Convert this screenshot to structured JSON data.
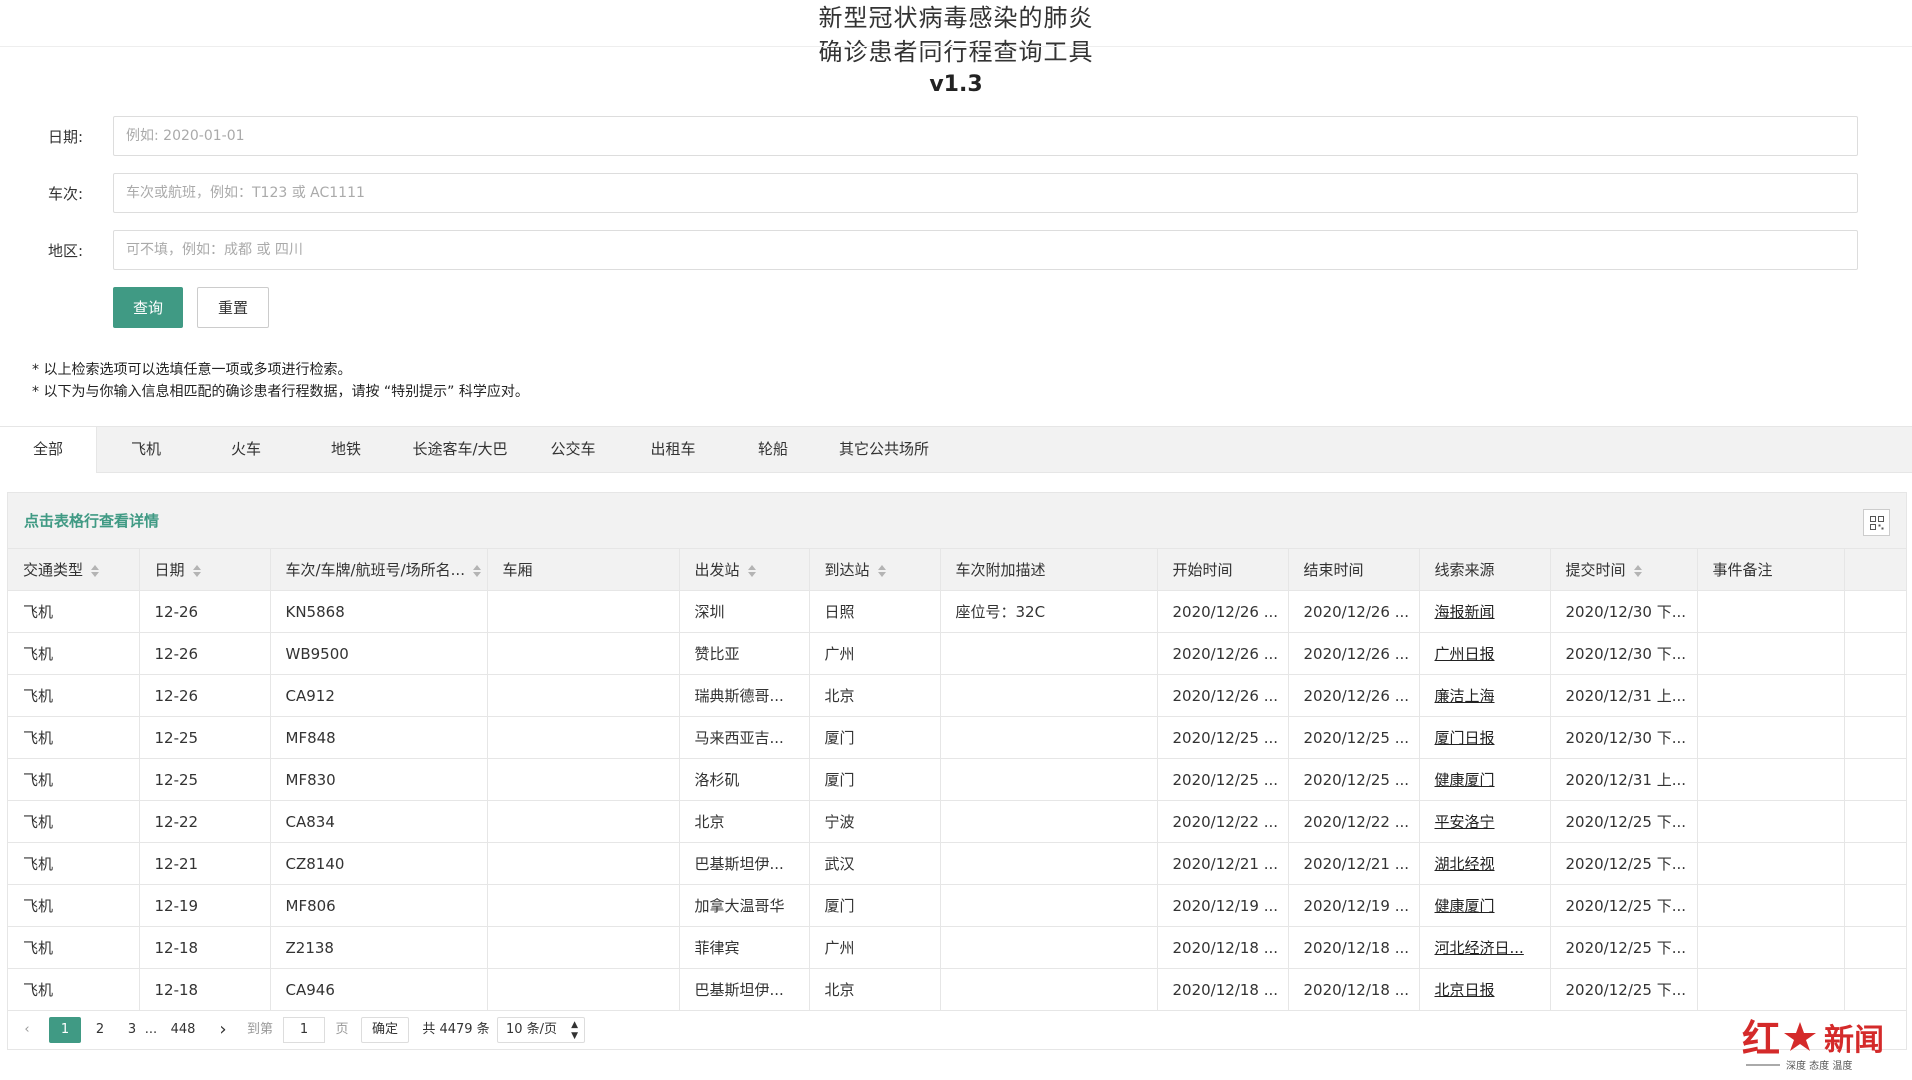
{
  "header": {
    "title_line1": "新型冠状病毒感染的肺炎",
    "title_line2": "确诊患者同行程查询工具",
    "version": "v1.3"
  },
  "form": {
    "date_label": "日期:",
    "date_placeholder": "例如: 2020-01-01",
    "train_label": "车次:",
    "train_placeholder": "车次或航班，例如：T123 或 AC1111",
    "region_label": "地区:",
    "region_placeholder": "可不填，例如：成都 或 四川",
    "query_button": "查询",
    "reset_button": "重置"
  },
  "notes": [
    "* 以上检索选项可以选填任意一项或多项进行检索。",
    "* 以下为与你输入信息相匹配的确诊患者行程数据，请按 “特别提示” 科学应对。"
  ],
  "tabs": [
    "全部",
    "飞机",
    "火车",
    "地铁",
    "长途客车/大巴",
    "公交车",
    "出租车",
    "轮船",
    "其它公共场所"
  ],
  "table": {
    "hint": "点击表格行查看详情",
    "columns": [
      "交通类型",
      "日期",
      "车次/车牌/航班号/场所名...",
      "车厢",
      "出发站",
      "到达站",
      "车次附加描述",
      "开始时间",
      "结束时间",
      "线索来源",
      "提交时间",
      "事件备注"
    ],
    "rows": [
      [
        "飞机",
        "12-26",
        "KN5868",
        "",
        "深圳",
        "日照",
        "座位号：32C",
        "2020/12/26 ...",
        "2020/12/26 ...",
        "海报新闻",
        "2020/12/30 下...",
        ""
      ],
      [
        "飞机",
        "12-26",
        "WB9500",
        "",
        "赞比亚",
        "广州",
        "",
        "2020/12/26 ...",
        "2020/12/26 ...",
        "广州日报",
        "2020/12/30 下...",
        ""
      ],
      [
        "飞机",
        "12-26",
        "CA912",
        "",
        "瑞典斯德哥...",
        "北京",
        "",
        "2020/12/26 ...",
        "2020/12/26 ...",
        "廉洁上海",
        "2020/12/31 上...",
        ""
      ],
      [
        "飞机",
        "12-25",
        "MF848",
        "",
        "马来西亚吉...",
        "厦门",
        "",
        "2020/12/25 ...",
        "2020/12/25 ...",
        "厦门日报",
        "2020/12/30 下...",
        ""
      ],
      [
        "飞机",
        "12-25",
        "MF830",
        "",
        "洛杉矶",
        "厦门",
        "",
        "2020/12/25 ...",
        "2020/12/25 ...",
        "健康厦门",
        "2020/12/31 上...",
        ""
      ],
      [
        "飞机",
        "12-22",
        "CA834",
        "",
        "北京",
        "宁波",
        "",
        "2020/12/22 ...",
        "2020/12/22 ...",
        "平安洛宁",
        "2020/12/25 下...",
        ""
      ],
      [
        "飞机",
        "12-21",
        "CZ8140",
        "",
        "巴基斯坦伊...",
        "武汉",
        "",
        "2020/12/21 ...",
        "2020/12/21 ...",
        "湖北经视",
        "2020/12/25 下...",
        ""
      ],
      [
        "飞机",
        "12-19",
        "MF806",
        "",
        "加拿大温哥华",
        "厦门",
        "",
        "2020/12/19 ...",
        "2020/12/19 ...",
        "健康厦门",
        "2020/12/25 下...",
        ""
      ],
      [
        "飞机",
        "12-18",
        "Z2138",
        "",
        "菲律宾",
        "广州",
        "",
        "2020/12/18 ...",
        "2020/12/18 ...",
        "河北经济日...",
        "2020/12/25 下...",
        ""
      ],
      [
        "飞机",
        "12-18",
        "CA946",
        "",
        "巴基斯坦伊...",
        "北京",
        "",
        "2020/12/18 ...",
        "2020/12/18 ...",
        "北京日报",
        "2020/12/25 下...",
        ""
      ]
    ]
  },
  "pagination": {
    "current": "1",
    "page2": "2",
    "page3": "3",
    "ellipsis": "...",
    "last": "448",
    "goto_label": "到第",
    "goto_value": "1",
    "page_unit": "页",
    "confirm": "确定",
    "total": "共 4479 条",
    "per_page": "10 条/页"
  },
  "watermark": {
    "brand": "红星新闻",
    "tagline": "深度 态度 温度"
  },
  "colors": {
    "accent": "#409a84",
    "brand_red": "#d42a2a"
  }
}
